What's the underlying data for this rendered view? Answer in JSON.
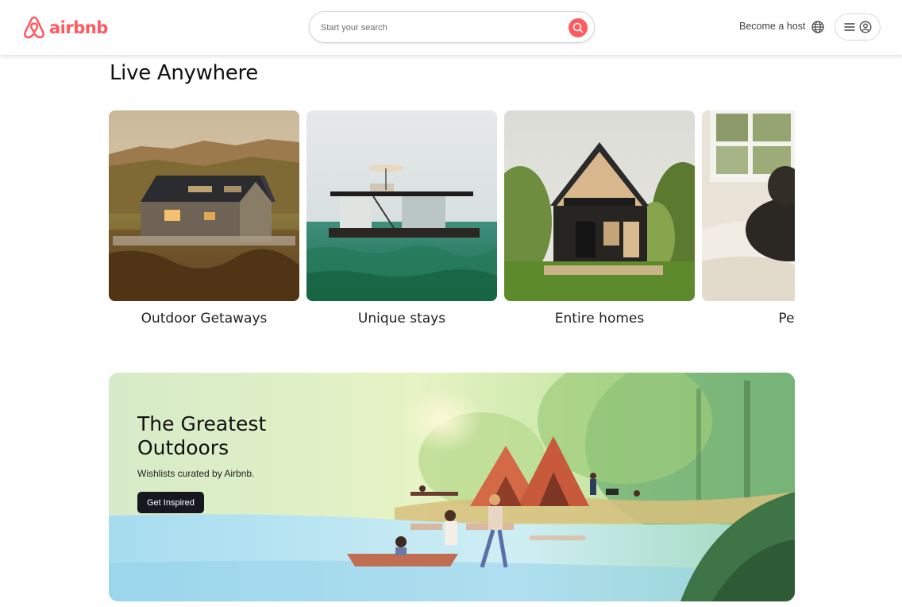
{
  "header": {
    "brand": "airbnb",
    "search_placeholder": "Start your search",
    "host_link": "Become a host",
    "brand_color": "#ff5a5f"
  },
  "section": {
    "title": "Live Anywhere",
    "cards": [
      {
        "label": "Outdoor Getaways",
        "image": "outdoor-cabin-photo"
      },
      {
        "label": "Unique stays",
        "image": "houseboat-photo"
      },
      {
        "label": "Entire homes",
        "image": "a-frame-house-photo"
      },
      {
        "label": "Pet al",
        "image": "dog-on-bed-photo"
      }
    ]
  },
  "banner": {
    "title": "The Greatest Outdoors",
    "subtitle": "Wishlists curated by Airbnb.",
    "button": "Get Inspired"
  },
  "icons": {
    "search": "search-icon",
    "globe": "globe-icon",
    "menu": "hamburger-icon",
    "user": "user-avatar-icon"
  }
}
